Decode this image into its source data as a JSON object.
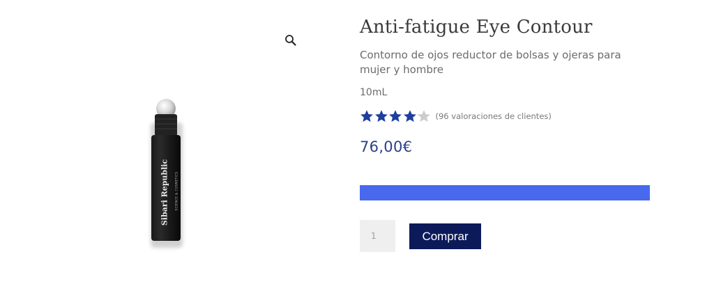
{
  "product": {
    "title": "Anti-fatigue Eye Contour",
    "subtitle": "Contorno de ojos reductor de bolsas y ojeras para mujer y hombre",
    "size": "10mL",
    "rating": 4.1,
    "rating_max": 5,
    "review_text": "(96 valoraciones de clientes)",
    "price": "76,00€",
    "quantity_value": "1",
    "buy_label": "Comprar",
    "bottle_brand": "Sibari Republic",
    "bottle_tagline": "SCIENCE & COSMETICS"
  },
  "colors": {
    "star_filled": "#1e3f9e",
    "star_empty": "#cccccc",
    "price": "#2b3f8a",
    "variation_bar": "#4868ee",
    "buy_button": "#0d1a5a"
  },
  "icons": {
    "zoom": "magnifier-icon",
    "star": "star-icon"
  }
}
